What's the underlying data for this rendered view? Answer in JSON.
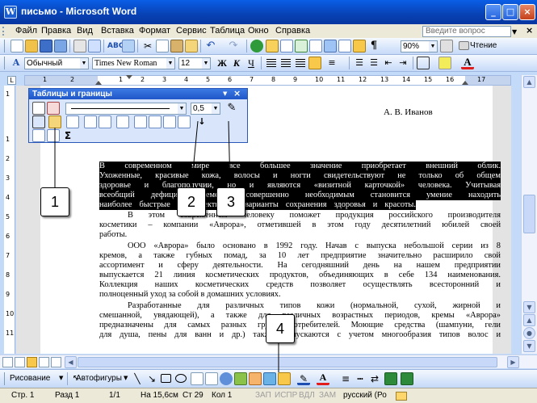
{
  "window": {
    "title": "письмо - Microsoft Word",
    "app_icon": "word-icon",
    "controls": [
      "_",
      "□",
      "×"
    ]
  },
  "menu": {
    "items": [
      "Файл",
      "Правка",
      "Вид",
      "Вставка",
      "Формат",
      "Сервис",
      "Таблица",
      "Окно",
      "Справка"
    ],
    "question_placeholder": "Введите вопрос",
    "close_mark": "×"
  },
  "standard_toolbar": {
    "zoom": "90%",
    "read_label": "Чтение"
  },
  "format_toolbar": {
    "style": "Обычный",
    "font": "Times New Roman",
    "size": "12",
    "bold": "Ж",
    "italic": "К",
    "underline": "Ч"
  },
  "ruler": {
    "numbers": [
      "1",
      "2",
      "1",
      "1",
      "2",
      "3",
      "4",
      "5",
      "6",
      "7",
      "8",
      "9",
      "10",
      "11",
      "12",
      "13",
      "14",
      "15",
      "16",
      "17"
    ]
  },
  "vruler": {
    "numbers": [
      "1",
      "1",
      "2",
      "3",
      "4",
      "5",
      "6",
      "7",
      "8",
      "9",
      "10",
      "11",
      "12",
      "13"
    ]
  },
  "tables_toolbar": {
    "title": "Таблицы и границы",
    "line_weight": "0,5",
    "sum_label": "Σ",
    "sort_label": "↓",
    "close_mark": "×"
  },
  "document": {
    "author": "А. В. Иванов",
    "highlighted_lines": [
      "В современном мире все большее значение приобретает внешний облик.",
      "Ухоженные, красивые кожа, волосы и ногти свидетельствуют не только об общем",
      "здоровье и благополучии, но и являются «визитной карточкой» человека. Учитывая",
      "всеобщий дефицит времени, совершенно необходимым становится умение находить",
      "наиболее быстрые и эффективные варианты сохранения здоровья и красоты."
    ],
    "lines": [
      "В этом современном человеку поможет продукция российского производителя",
      "косметики – компании «Аврора», отметившей в этом году десятилетний юбилей своей",
      "работы.",
      "ООО «Аврора» было основано в 1992 году. Начав с выпуска небольшой серии из 8",
      "кремов, а также губных помад, за 10 лет предприятие значительно расширило свой",
      "ассортимент и сферу деятельности. На сегодняшний день на нашем предприятии",
      "выпускается 21 линия косметических продуктов, объединяющих в себе 134 наименования.",
      "Коллекция наших косметических средств позволяет осуществлять всесторонний и",
      "полноценный уход за собой в домашних условиях.",
      "Разработанные для различных типов кожи (нормальной, сухой, жирной и",
      "смешанной, увядающей), а также для различных возрастных периодов, кремы «Аврора»",
      "предназначены для самых разных групп потребителей. Моющие средства (шампуни, гели",
      "для душа, пены для ванн и др.) также выпускаются с учетом многообразия типов волос и"
    ]
  },
  "callouts": [
    "1",
    "2",
    "3",
    "4"
  ],
  "drawing_toolbar": {
    "draw_label": "Рисование",
    "autoshapes_label": "Автофигуры"
  },
  "status": {
    "page": "Стр. 1",
    "section": "Разд 1",
    "pages": "1/1",
    "position": "На 15,6см",
    "line": "Ст 29",
    "column": "Кол 1",
    "modes": [
      "ЗАП",
      "ИСПР",
      "ВДЛ",
      "ЗАМ"
    ],
    "language": "русский (Ро"
  },
  "colors": {
    "titlebar": "#0842b4",
    "toolbar": "#c6daf8",
    "selection": "#000000",
    "window_bg": "#ece9d8"
  }
}
